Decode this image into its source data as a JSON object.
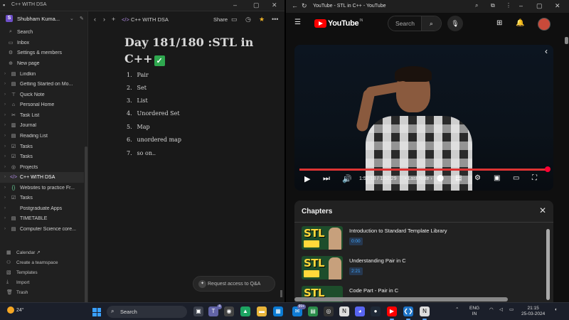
{
  "notion": {
    "window_title": "C++ WITH DSA",
    "workspace": {
      "initial": "S",
      "name": "Shubham Kuma..."
    },
    "nav": [
      "Search",
      "Inbox",
      "Settings & members",
      "New page"
    ],
    "pages": [
      {
        "label": "Lindkin",
        "icon": "page-icon"
      },
      {
        "label": "Getting Started on Mo...",
        "icon": "page-icon"
      },
      {
        "label": "Quick Note",
        "icon": "pin-icon"
      },
      {
        "label": "Personal Home",
        "icon": "home-icon"
      },
      {
        "label": "Task List",
        "icon": "scissors-icon"
      },
      {
        "label": "Journal",
        "icon": "book-icon"
      },
      {
        "label": "Reading List",
        "icon": "page-icon"
      },
      {
        "label": "Tasks",
        "icon": "checkbox-icon"
      },
      {
        "label": "Tasks",
        "icon": "checkbox-icon"
      },
      {
        "label": "Projects",
        "icon": "target-icon"
      },
      {
        "label": "C++ WITH DSA",
        "icon": "code-icon"
      },
      {
        "label": "Websites to practice Fr...",
        "icon": "brackets-icon"
      },
      {
        "label": "Tasks",
        "icon": "checkbox-icon"
      },
      {
        "label": "Postgraduate Apps",
        "icon": "blank-icon"
      },
      {
        "label": "TIMETABLE",
        "icon": "page-icon"
      },
      {
        "label": "Computer Science core...",
        "icon": "page-icon"
      }
    ],
    "bottom": [
      "Calendar ↗",
      "Create a teamspace",
      "Templates",
      "Import",
      "Trash"
    ],
    "breadcrumb": "C++ WITH DSA",
    "share_label": "Share",
    "page_title": "Day 181/180 :STL in C++",
    "list": [
      "Pair",
      "Set",
      "List",
      "Unordered Set",
      "Map",
      "unordered map",
      "so on.."
    ],
    "qa_button": "Request access to Q&A"
  },
  "browser": {
    "tab_title": "YouTube - STL in C++ - YouTube",
    "logo_text": "YouTube",
    "logo_region": "IN",
    "search_placeholder": "Search",
    "video": {
      "time": "1:52:18 / 1:52:29",
      "chapter": "• Last Note",
      "chapter_arrow": "›",
      "progress": 0.998
    },
    "chapters_heading": "Chapters",
    "chapters": [
      {
        "title": "Introduction to Standard Template Library",
        "time": "0:00"
      },
      {
        "title": "Understanding Pair in C",
        "time": "2:21"
      },
      {
        "title": "Code Part - Pair in C",
        "time": ""
      }
    ],
    "thumb_text": "STL"
  },
  "taskbar": {
    "weather": "24°",
    "search_label": "Search",
    "language": "ENG",
    "region": "IN",
    "time": "21:15",
    "date": "25-03-2024",
    "badges": {
      "teams": "4",
      "mail": "99+"
    }
  },
  "colors": {
    "youtube_red": "#ff0000",
    "notion_bg": "#191919",
    "accent_blue": "#3ea6ff"
  }
}
